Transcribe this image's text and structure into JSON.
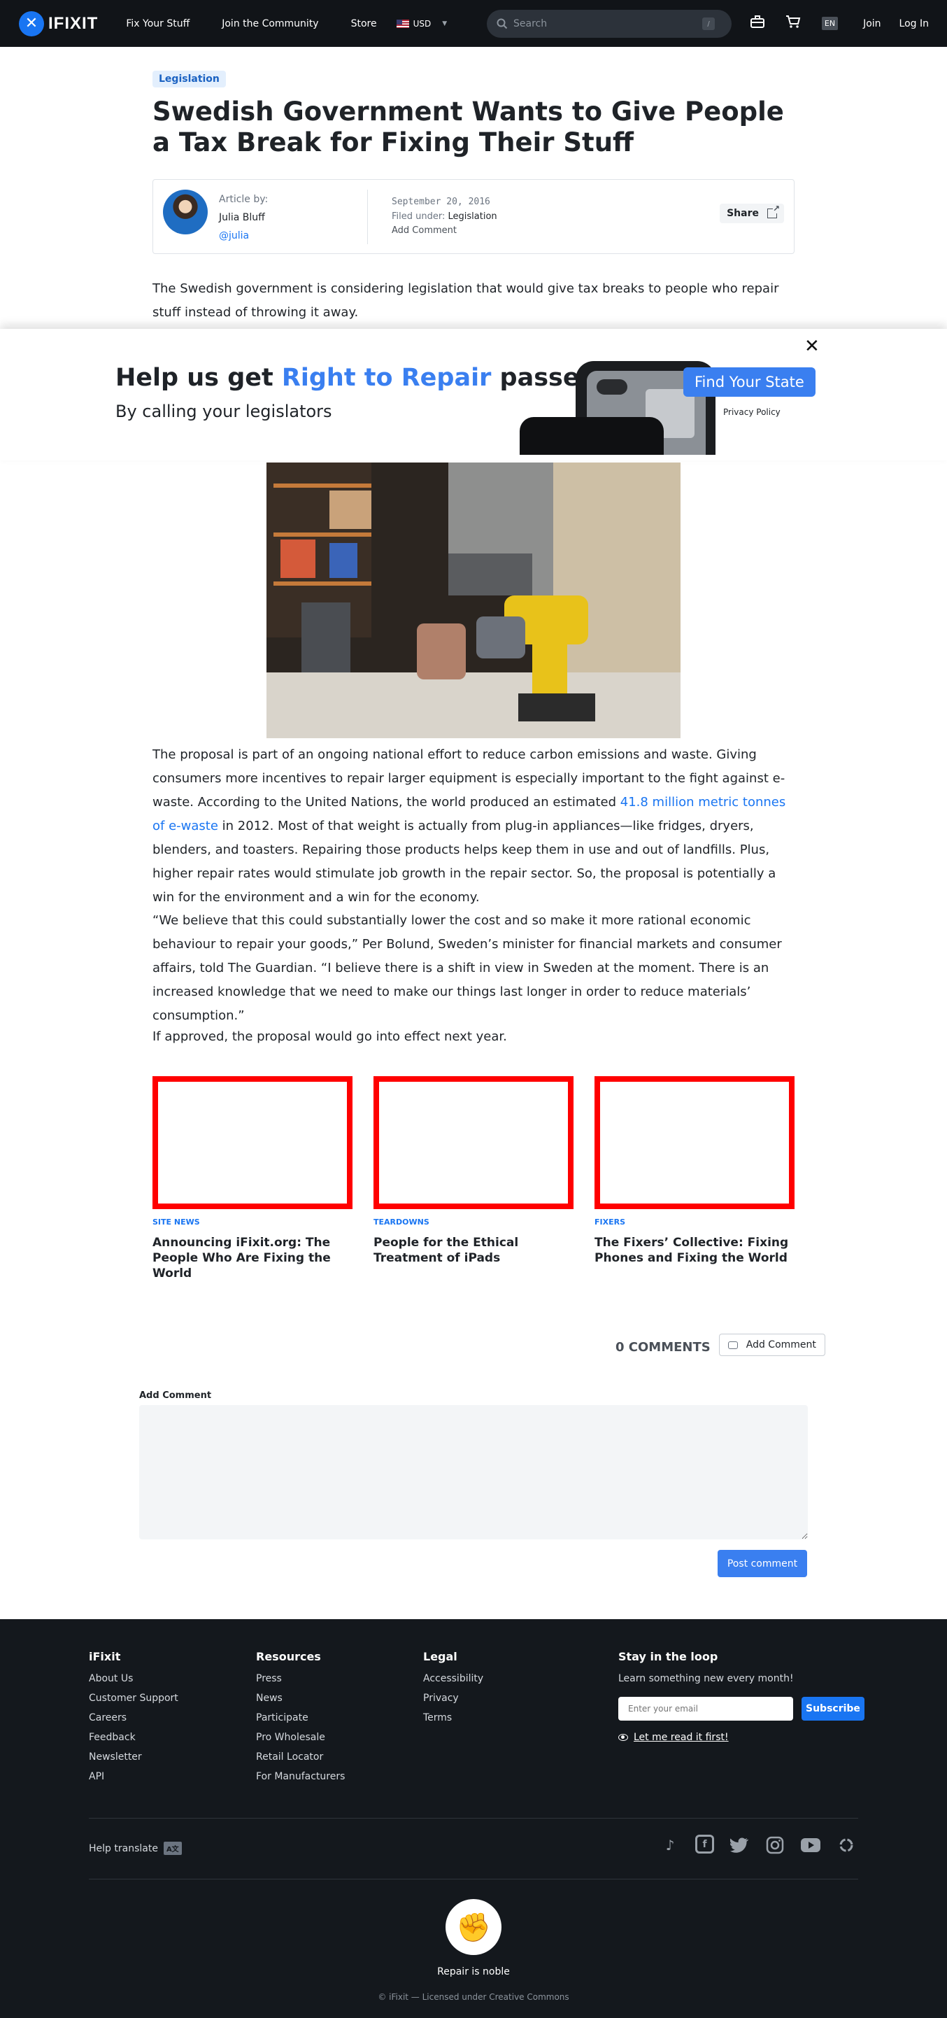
{
  "header": {
    "logo_text": "IFIXIT",
    "nav": [
      "Fix Your Stuff",
      "Join the Community",
      "Store"
    ],
    "currency": "USD",
    "search_placeholder": "Search",
    "search_shortcut": "/",
    "lang": "EN",
    "join": "Join",
    "login": "Log In"
  },
  "article": {
    "tag": "Legislation",
    "title": "Swedish Government Wants to Give People a Tax Break for Fixing Their Stuff",
    "byline": {
      "label": "Article by:",
      "author": "Julia Bluff",
      "handle": "@julia",
      "date": "September 20, 2016",
      "filed_label": "Filed under:",
      "filed_value": "Legislation",
      "add_comment": "Add Comment",
      "share": "Share"
    },
    "lede": "The Swedish government is considering legislation that would give tax breaks to people who repair stuff instead of throwing it away.",
    "p1_before": "The proposal is part of an ongoing national effort to reduce carbon emissions and waste. Giving consumers more incentives to repair larger equipment is especially important to the fight against e-waste. According to the United Nations, the world produced an estimated ",
    "p1_link": "41.8 million metric tonnes of e-waste",
    "p1_after": " in 2012. Most of that weight is actually from plug-in appliances—like fridges, dryers, blenders, and toasters. Repairing those products helps keep them in use and out of landfills. Plus, higher repair rates would stimulate job growth in the repair sector. So, the proposal is potentially a win for the environment and a win for the economy.",
    "p2": "“We believe that this could substantially lower the cost and so make it more rational economic behaviour to repair your goods,” Per Bolund, Sweden’s minister for financial markets and consumer affairs, told The Guardian. “I believe there is a shift in view in Sweden at the moment. There is an increased knowledge that we need to make our things last longer in order to reduce materials’ consumption.”",
    "p3": "If approved, the proposal would go into effect next year."
  },
  "banner": {
    "close": "✕",
    "headline_a": "Help us get ",
    "headline_hl": "Right to Repair",
    "headline_b": " passed",
    "subhead": "By calling your legislators",
    "cta": "Find Your State",
    "privacy": "Privacy Policy"
  },
  "related": [
    {
      "category": "SITE NEWS",
      "title": "Announcing iFixit.org: The People Who Are Fixing the World"
    },
    {
      "category": "TEARDOWNS",
      "title": "People for the Ethical Treatment of iPads"
    },
    {
      "category": "FIXERS",
      "title": "The Fixers’ Collective: Fixing Phones and Fixing the World"
    }
  ],
  "comments": {
    "count_label": "0 COMMENTS",
    "add_button": "Add Comment",
    "add_label": "Add Comment",
    "post_button": "Post comment"
  },
  "footer": {
    "col1": {
      "title": "iFixit",
      "items": [
        "About Us",
        "Customer Support",
        "Careers",
        "Feedback",
        "Newsletter",
        "API"
      ]
    },
    "col2": {
      "title": "Resources",
      "items": [
        "Press",
        "News",
        "Participate",
        "Pro Wholesale",
        "Retail Locator",
        "For Manufacturers"
      ]
    },
    "col3": {
      "title": "Legal",
      "items": [
        "Accessibility",
        "Privacy",
        "Terms"
      ]
    },
    "newsletter": {
      "title": "Stay in the loop",
      "text": "Learn something new every month!",
      "placeholder": "Enter your email",
      "subscribe": "Subscribe",
      "read_first": "Let me read it first!"
    },
    "help_translate": "Help translate",
    "tagline": "Repair is noble",
    "copyright": "© iFixit — Licensed under Creative Commons"
  },
  "colors": {
    "brand_blue": "#1975f2",
    "cta_blue": "#3a7ff0",
    "footer_bg": "#14181d",
    "header_bg": "#111418"
  }
}
